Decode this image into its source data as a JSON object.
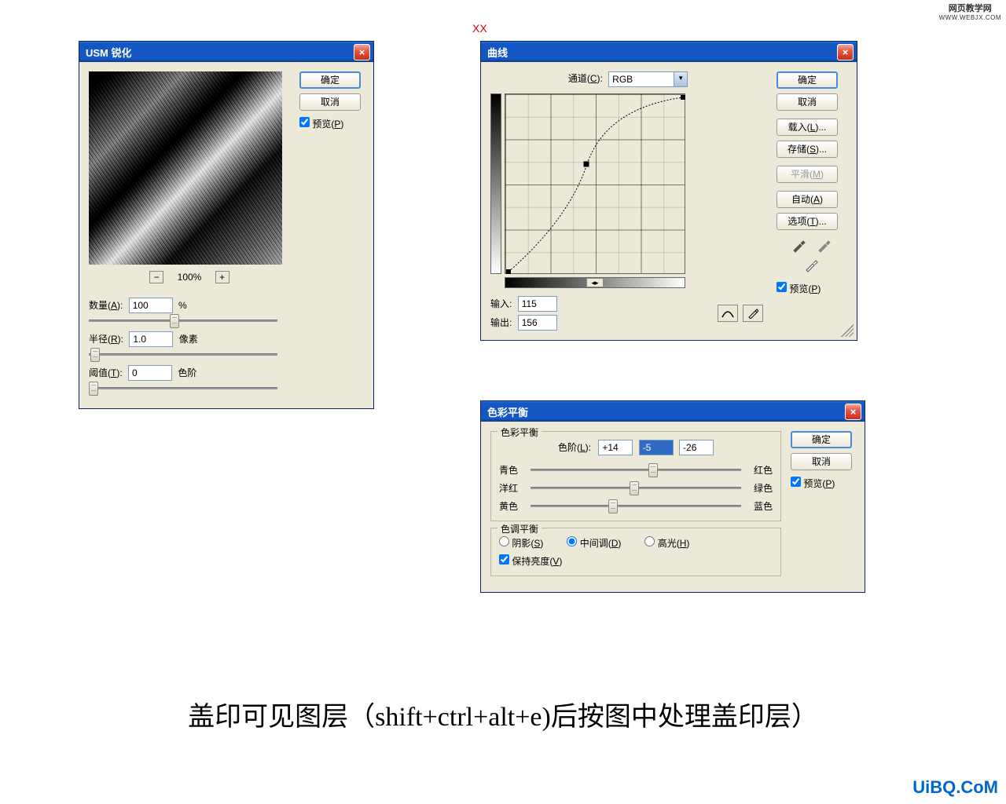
{
  "top_watermark": {
    "line1": "网页教学网",
    "line2": "WWW.WEBJX.COM"
  },
  "bottom_watermark": "UiBQ.CoM",
  "xx_label": "XX",
  "caption": "盖印可见图层（shift+ctrl+alt+e)后按图中处理盖印层）",
  "usm": {
    "title": "USM 锐化",
    "ok": "确定",
    "cancel": "取消",
    "preview_label": "预览(",
    "preview_key": "P",
    "preview_suffix": ")",
    "zoom": "100%",
    "minus": "−",
    "plus": "+",
    "amount_label": "数量(",
    "amount_key": "A",
    "amount_suffix": "):",
    "amount_val": "100",
    "amount_unit": "%",
    "radius_label": "半径(",
    "radius_key": "R",
    "radius_suffix": "):",
    "radius_val": "1.0",
    "radius_unit": "像素",
    "thresh_label": "阈值(",
    "thresh_key": "T",
    "thresh_suffix": "):",
    "thresh_val": "0",
    "thresh_unit": "色阶"
  },
  "curves": {
    "title": "曲线",
    "channel_label": "通道(",
    "channel_key": "C",
    "channel_suffix": "):",
    "channel_val": "RGB",
    "ok": "确定",
    "cancel": "取消",
    "load": "载入(",
    "load_key": "L",
    "load_suffix": ")...",
    "save": "存储(",
    "save_key": "S",
    "save_suffix": ")...",
    "smooth": "平滑(",
    "smooth_key": "M",
    "smooth_suffix": ")",
    "auto": "自动(",
    "auto_key": "A",
    "auto_suffix": ")",
    "options": "选项(",
    "options_key": "T",
    "options_suffix": ")...",
    "input_label": "输入:",
    "input_val": "115",
    "output_label": "输出:",
    "output_val": "156",
    "preview_label": "预览(",
    "preview_key": "P",
    "preview_suffix": ")",
    "arrows": "◂▸"
  },
  "colorbal": {
    "title": "色彩平衡",
    "group1": "色彩平衡",
    "levels_label": "色阶(",
    "levels_key": "L",
    "levels_suffix": "):",
    "v1": "+14",
    "v2": "-5",
    "v3": "-26",
    "cyan": "青色",
    "red": "红色",
    "magenta": "洋红",
    "green": "绿色",
    "yellow": "黄色",
    "blue": "蓝色",
    "group2": "色调平衡",
    "shadows": "阴影(",
    "shadows_key": "S",
    "shadows_suffix": ")",
    "mid": "中间调(",
    "mid_key": "D",
    "mid_suffix": ")",
    "high": "高光(",
    "high_key": "H",
    "high_suffix": ")",
    "preserve": "保持亮度(",
    "preserve_key": "V",
    "preserve_suffix": ")",
    "ok": "确定",
    "cancel": "取消",
    "preview_label": "预览(",
    "preview_key": "P",
    "preview_suffix": ")"
  }
}
